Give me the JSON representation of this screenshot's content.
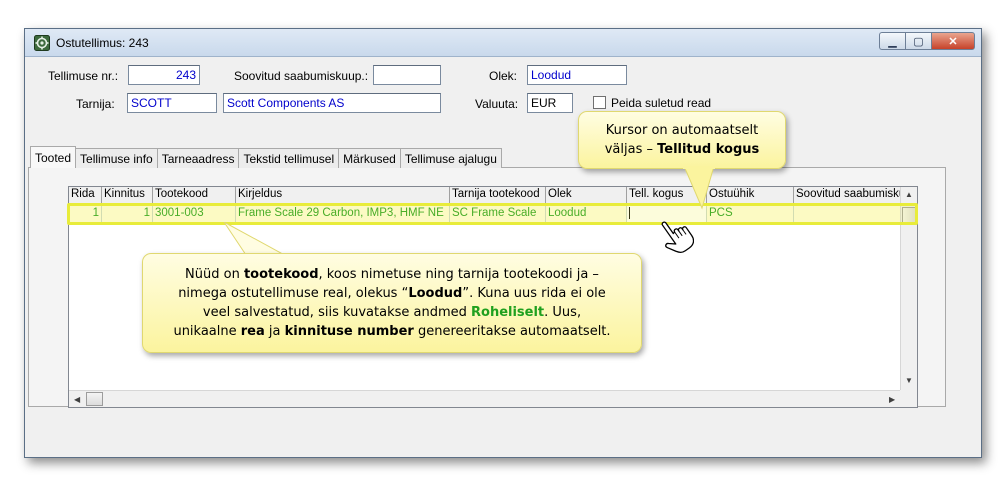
{
  "window": {
    "title": "Ostutellimus: 243"
  },
  "header": {
    "order_no_label": "Tellimuse nr.:",
    "order_no_value": "243",
    "desired_arrival_label": "Soovitud saabumiskuup.:",
    "desired_arrival_value": "",
    "status_label": "Olek:",
    "status_value": "Loodud",
    "supplier_label": "Tarnija:",
    "supplier_code": "SCOTT",
    "supplier_name": "Scott Components AS",
    "currency_label": "Valuuta:",
    "currency_value": "EUR",
    "hide_closed_label": "Peida suletud read"
  },
  "tabs": [
    {
      "label": "Tooted"
    },
    {
      "label": "Tellimuse info"
    },
    {
      "label": "Tarneaadress"
    },
    {
      "label": "Tekstid tellimusel"
    },
    {
      "label": "Märkused"
    },
    {
      "label": "Tellimuse ajalugu"
    }
  ],
  "table": {
    "columns": [
      "Rida",
      "Kinnitus",
      "Tootekood",
      "Kirjeldus",
      "Tarnija tootekood",
      "Olek",
      "Tell. kogus",
      "Ostuühik",
      "Soovitud saabumiskuup"
    ],
    "rows": [
      [
        "1",
        "1",
        "3001-003",
        "Frame Scale 29 Carbon, IMP3, HMF NE",
        "SC Frame Scale",
        "Loodud",
        "",
        "PCS",
        ""
      ]
    ]
  },
  "callouts": {
    "cursor_line1": "Kursor on automaatselt",
    "cursor_line2a": "väljas – ",
    "cursor_line2b": "Tellitud kogus",
    "main_l1a": "Nüüd on ",
    "main_l1b": "tootekood",
    "main_l1c": ", koos nimetuse ning tarnija tootekoodi ja –",
    "main_l2a": "nimega ostutellimuse real, olekus “",
    "main_l2b": "Loodud",
    "main_l2c": "”.   Kuna uus rida ei ole",
    "main_l3a": "veel salvestatud, siis kuvatakse andmed ",
    "main_l3b": "Roheliselt",
    "main_l3c": ".  Uus,",
    "main_l4a": "unikaalne ",
    "main_l4b": "rea",
    "main_l4c": " ja ",
    "main_l4d": "kinnituse number",
    "main_l4e": " genereeritakse automaatselt."
  },
  "colors": {
    "new_row_text": "#1a9a1a",
    "highlight": "#e8ec3a",
    "callout_bg": "#fbf49e"
  }
}
